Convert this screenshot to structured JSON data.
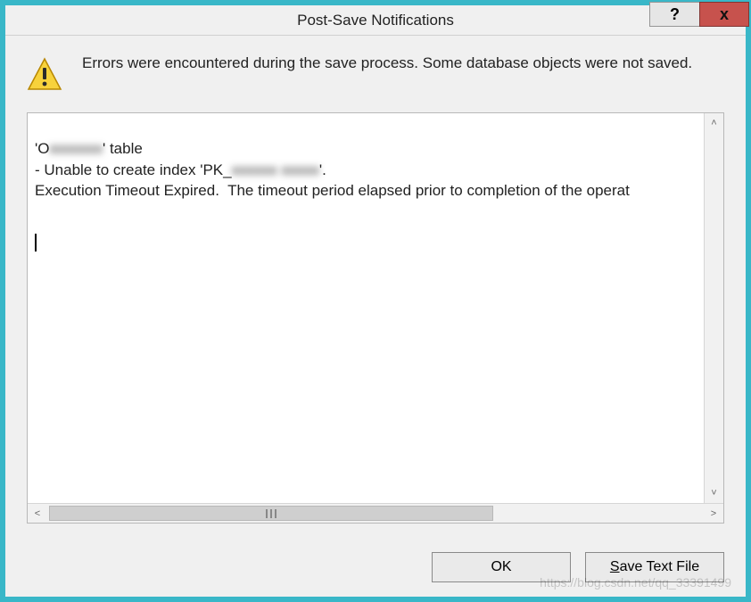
{
  "titlebar": {
    "title": "Post-Save Notifications",
    "help_glyph": "?",
    "close_glyph": "x"
  },
  "message": {
    "text": "Errors were encountered during the save process. Some database objects were not saved.",
    "icon": "warning-icon"
  },
  "details": {
    "line1_prefix": "'O",
    "line1_redacted": "xxxxxxx",
    "line1_suffix": "' table",
    "line2_prefix": "- Unable to create index 'PK_",
    "line2_redacted": "xxxxxx xxxxx",
    "line3": "Execution Timeout Expired.  The timeout period elapsed prior to completion of the operat"
  },
  "scroll": {
    "up": "˄",
    "down": "˅",
    "left": "<",
    "right": ">"
  },
  "buttons": {
    "ok": "OK",
    "save_accel": "S",
    "save_rest": "ave Text File"
  },
  "watermark": "https://blog.csdn.net/qq_33391499"
}
